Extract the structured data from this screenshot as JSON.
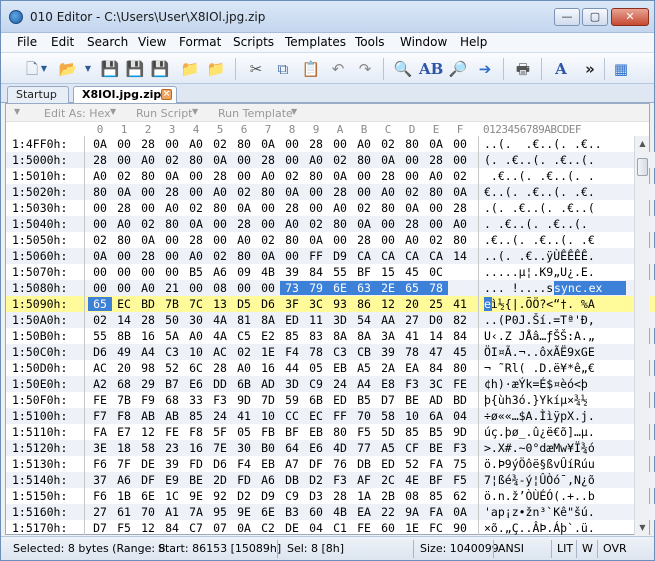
{
  "window": {
    "title": "010 Editor - C:\\Users\\User\\X8IOl.jpg.zip",
    "min_glyph": "—",
    "max_glyph": "▢",
    "close_glyph": "✕"
  },
  "menu": [
    "File",
    "Edit",
    "Search",
    "View",
    "Format",
    "Scripts",
    "Templates",
    "Tools",
    "Window",
    "Help"
  ],
  "toolbar": {
    "icons": [
      "new-file-icon",
      "new-dropdown-icon",
      "open-icon",
      "open-dropdown-icon",
      "save-icon",
      "save-as-icon",
      "save-all-icon",
      "close-file-icon",
      "close-all-icon",
      "cut-icon",
      "copy-icon",
      "paste-icon",
      "undo-icon",
      "redo-icon",
      "find-icon",
      "replace-icon",
      "find-in-files-icon",
      "goto-icon",
      "print-icon",
      "font-icon",
      "more-icon",
      "calculator-icon"
    ],
    "more_label": "»"
  },
  "tabs": [
    {
      "label": "Startup",
      "active": false
    },
    {
      "label": "X8IOl.jpg.zip",
      "active": true
    }
  ],
  "options_bar": {
    "edit_as": "Edit As: Hex",
    "run_script": "Run Script",
    "run_template": "Run Template"
  },
  "hex_view": {
    "columns": [
      "0",
      "1",
      "2",
      "3",
      "4",
      "5",
      "6",
      "7",
      "8",
      "9",
      "A",
      "B",
      "C",
      "D",
      "E",
      "F"
    ],
    "ascii_header": "0123456789ABCDEF",
    "rows": [
      {
        "addr": "1:4FF0h:",
        "bytes": [
          "0A",
          "00",
          "28",
          "00",
          "A0",
          "02",
          "80",
          "0A",
          "00",
          "28",
          "00",
          "A0",
          "02",
          "80",
          "0A",
          "00"
        ],
        "ascii": "..(.  .€..(. .€.."
      },
      {
        "addr": "1:5000h:",
        "bytes": [
          "28",
          "00",
          "A0",
          "02",
          "80",
          "0A",
          "00",
          "28",
          "00",
          "A0",
          "02",
          "80",
          "0A",
          "00",
          "28",
          "00"
        ],
        "ascii": "(. .€..(. .€..(."
      },
      {
        "addr": "1:5010h:",
        "bytes": [
          "A0",
          "02",
          "80",
          "0A",
          "00",
          "28",
          "00",
          "A0",
          "02",
          "80",
          "0A",
          "00",
          "28",
          "00",
          "A0",
          "02"
        ],
        "ascii": " .€..(. .€..(. ."
      },
      {
        "addr": "1:5020h:",
        "bytes": [
          "80",
          "0A",
          "00",
          "28",
          "00",
          "A0",
          "02",
          "80",
          "0A",
          "00",
          "28",
          "00",
          "A0",
          "02",
          "80",
          "0A"
        ],
        "ascii": "€..(. .€..(. .€."
      },
      {
        "addr": "1:5030h:",
        "bytes": [
          "00",
          "28",
          "00",
          "A0",
          "02",
          "80",
          "0A",
          "00",
          "28",
          "00",
          "A0",
          "02",
          "80",
          "0A",
          "00",
          "28"
        ],
        "ascii": ".(. .€..(. .€..("
      },
      {
        "addr": "1:5040h:",
        "bytes": [
          "00",
          "A0",
          "02",
          "80",
          "0A",
          "00",
          "28",
          "00",
          "A0",
          "02",
          "80",
          "0A",
          "00",
          "28",
          "00",
          "A0"
        ],
        "ascii": ". .€..(. .€..(. "
      },
      {
        "addr": "1:5050h:",
        "bytes": [
          "02",
          "80",
          "0A",
          "00",
          "28",
          "00",
          "A0",
          "02",
          "80",
          "0A",
          "00",
          "28",
          "00",
          "A0",
          "02",
          "80"
        ],
        "ascii": ".€..(. .€..(. .€"
      },
      {
        "addr": "1:5060h:",
        "bytes": [
          "0A",
          "00",
          "28",
          "00",
          "A0",
          "02",
          "80",
          "0A",
          "00",
          "FF",
          "D9",
          "CA",
          "CA",
          "CA",
          "CA",
          "14"
        ],
        "ascii": "..(. .€..ÿÙÊÊÊÊ."
      },
      {
        "addr": "1:5070h:",
        "bytes": [
          "00",
          "00",
          "00",
          "00",
          "B5",
          "A6",
          "09",
          "4B",
          "39",
          "84",
          "55",
          "BF",
          "15",
          "45",
          "0C"
        ],
        "ascii": ".....µ¦.K9„U¿.E."
      },
      {
        "addr": "1:5080h:",
        "bytes": [
          "00",
          "00",
          "A0",
          "21",
          "00",
          "08",
          "00",
          "00",
          "73",
          "79",
          "6E",
          "63",
          "2E",
          "65",
          "78"
        ],
        "ascii": "... !....sync.ex"
      },
      {
        "addr": "1:5090h:",
        "bytes": [
          "65",
          "EC",
          "BD",
          "7B",
          "7C",
          "13",
          "D5",
          "D6",
          "3F",
          "3C",
          "93",
          "86",
          "12",
          "20",
          "25",
          "41"
        ],
        "ascii": "eì½{|.ÕÖ?<“†. %A"
      },
      {
        "addr": "1:50A0h:",
        "bytes": [
          "02",
          "14",
          "28",
          "50",
          "30",
          "4A",
          "81",
          "8A",
          "ED",
          "11",
          "3D",
          "54",
          "AA",
          "27",
          "D0",
          "82"
        ],
        "ascii": "..(P0J.Ší.=Tª'Ð‚"
      },
      {
        "addr": "1:50B0h:",
        "bytes": [
          "55",
          "8B",
          "16",
          "5A",
          "A0",
          "4A",
          "C5",
          "E2",
          "85",
          "83",
          "8A",
          "8A",
          "3A",
          "41",
          "14",
          "84"
        ],
        "ascii": "U‹.Z JÅâ…ƒŠŠ:A.„"
      },
      {
        "addr": "1:50C0h:",
        "bytes": [
          "D6",
          "49",
          "A4",
          "C3",
          "10",
          "AC",
          "02",
          "1E",
          "F4",
          "78",
          "C3",
          "CB",
          "39",
          "78",
          "47",
          "45"
        ],
        "ascii": "ÖI¤Ã.¬..ôxÃË9xGE"
      },
      {
        "addr": "1:50D0h:",
        "bytes": [
          "AC",
          "20",
          "98",
          "52",
          "6C",
          "28",
          "A0",
          "16",
          "44",
          "05",
          "EB",
          "A5",
          "2A",
          "EA",
          "84",
          "80"
        ],
        "ascii": "¬ ˜Rl( .D.ë¥*ê„€"
      },
      {
        "addr": "1:50E0h:",
        "bytes": [
          "A2",
          "68",
          "29",
          "B7",
          "E6",
          "DD",
          "6B",
          "AD",
          "3D",
          "C9",
          "24",
          "A4",
          "E8",
          "F3",
          "3C",
          "FE"
        ],
        "ascii": "¢h)·æÝk­=É$¤èó<þ"
      },
      {
        "addr": "1:50F0h:",
        "bytes": [
          "FE",
          "7B",
          "F9",
          "68",
          "33",
          "F3",
          "9D",
          "7D",
          "59",
          "6B",
          "ED",
          "B5",
          "D7",
          "BE",
          "AD",
          "BD"
        ],
        "ascii": "þ{ùh3ó.}Ykíµ×¾­½"
      },
      {
        "addr": "1:5100h:",
        "bytes": [
          "F7",
          "F8",
          "AB",
          "AB",
          "85",
          "24",
          "41",
          "10",
          "CC",
          "EC",
          "FF",
          "70",
          "58",
          "10",
          "6A",
          "04"
        ],
        "ascii": "÷ø««…$A.ÌìÿpX.j."
      },
      {
        "addr": "1:5110h:",
        "bytes": [
          "FA",
          "E7",
          "12",
          "FE",
          "F8",
          "5F",
          "05",
          "FB",
          "BF",
          "EB",
          "80",
          "F5",
          "5D",
          "85",
          "B5",
          "9D"
        ],
        "ascii": "úç.þø_.û¿ë€õ]…µ."
      },
      {
        "addr": "1:5120h:",
        "bytes": [
          "3E",
          "18",
          "58",
          "23",
          "16",
          "7E",
          "30",
          "B0",
          "64",
          "E6",
          "4D",
          "77",
          "A5",
          "CF",
          "BE",
          "F3"
        ],
        "ascii": ">.X#.~0°dæMw¥Ï¾ó"
      },
      {
        "addr": "1:5130h:",
        "bytes": [
          "F6",
          "7F",
          "DE",
          "39",
          "FD",
          "D6",
          "F4",
          "EB",
          "A7",
          "DF",
          "76",
          "DB",
          "ED",
          "52",
          "FA",
          "75"
        ],
        "ascii": "ö.Þ9ýÖôë§ßvÛíRúu"
      },
      {
        "addr": "1:5140h:",
        "bytes": [
          "37",
          "A6",
          "DF",
          "E9",
          "BE",
          "2D",
          "FD",
          "A6",
          "DB",
          "D2",
          "F3",
          "AF",
          "2C",
          "4E",
          "BF",
          "F5"
        ],
        "ascii": "7¦ßé¾-ý¦ÛÒó¯,N¿õ"
      },
      {
        "addr": "1:5150h:",
        "bytes": [
          "F6",
          "1B",
          "6E",
          "1C",
          "9E",
          "92",
          "D2",
          "D9",
          "C9",
          "D3",
          "28",
          "1A",
          "2B",
          "08",
          "85",
          "62"
        ],
        "ascii": "ö.n.ž’ÒÙÉÓ(.+..b"
      },
      {
        "addr": "1:5160h:",
        "bytes": [
          "27",
          "61",
          "70",
          "A1",
          "7A",
          "95",
          "9E",
          "6E",
          "B3",
          "60",
          "4B",
          "EA",
          "22",
          "9A",
          "FA",
          "0A"
        ],
        "ascii": "'ap¡z•žn³`Kê\"šú."
      },
      {
        "addr": "1:5170h:",
        "bytes": [
          "D7",
          "F5",
          "12",
          "84",
          "C7",
          "07",
          "0A",
          "C2",
          "DE",
          "04",
          "C1",
          "FE",
          "60",
          "1E",
          "FC",
          "90"
        ],
        "ascii": "×õ.„Ç..ÂÞ.Áþ`.ü."
      }
    ]
  },
  "status": {
    "selected": "Selected: 8 bytes (Range: 8",
    "start": "Start: 86153 [15089h]",
    "sel": "Sel: 8 [8h]",
    "size": "Size: 1040099",
    "encoding": "ANSI",
    "lit": "LIT",
    "w": "W",
    "ovr": "OVR"
  }
}
